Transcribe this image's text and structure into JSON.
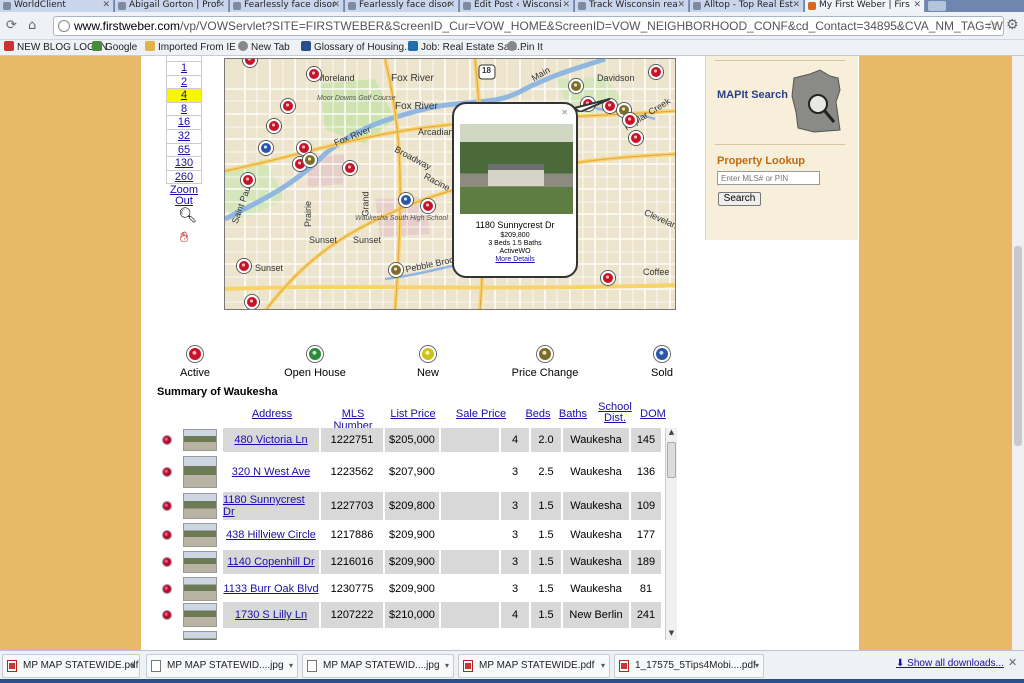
{
  "tabs": [
    {
      "label": "WorldClient"
    },
    {
      "label": "Abigail Gorton | Prof"
    },
    {
      "label": "Fearlessly face disor"
    },
    {
      "label": "Fearlessly face disor"
    },
    {
      "label": "Edit Post ‹ Wisconsi"
    },
    {
      "label": "Track Wisconsin rea"
    },
    {
      "label": "Alltop - Top Real Est"
    },
    {
      "label": "My First Weber | Firs"
    }
  ],
  "address": {
    "host": "www.firstweber.com",
    "path": "/vp/VOWServlet?SITE=FIRSTWEBER&ScreenID_Cur=VOW_HOME&ScreenID=VOW_NEIGHBORHOOD_CONF&cd_Contact=34895&CVA_NM_TAG=Waukesha"
  },
  "bookmarks": [
    {
      "label": "NEW BLOG LOG IN"
    },
    {
      "label": "Google"
    },
    {
      "label": "Imported From IE"
    },
    {
      "label": "New Tab"
    },
    {
      "label": "Glossary of Housing..."
    },
    {
      "label": "Job: Real Estate Sale..."
    },
    {
      "label": "Pin It"
    }
  ],
  "zoom": {
    "levels": [
      "1",
      "2",
      "4",
      "8",
      "16",
      "32",
      "65",
      "130",
      "260"
    ],
    "selected": "4",
    "zoom_out": "Zoom Out"
  },
  "map": {
    "labels": [
      "Fox River",
      "Fox River",
      "Fox River",
      "Moreland",
      "Moor Downs Golf Course",
      "Broadway",
      "Arcadian",
      "Racine",
      "Grand",
      "Sunset",
      "Sunset",
      "Sunset",
      "Waukesha South High School",
      "Pebble Brook",
      "Saint Paul",
      "Prairie",
      "Davidson",
      "Cleveland",
      "Coffee",
      "Main",
      "Poplar Creek"
    ],
    "highway": "18"
  },
  "popup": {
    "address": "1180 Sunnycrest Dr",
    "price": "$209,800",
    "beds_baths": "3 Beds 1.5 Baths",
    "status": "ActiveWO",
    "more": "More Details"
  },
  "legend": [
    "Active",
    "Open House",
    "New",
    "Price Change",
    "Sold"
  ],
  "summary_title": "Summary of Waukesha",
  "columns": [
    "Address",
    "MLS Number",
    "List Price",
    "Sale Price",
    "Beds",
    "Baths",
    "School Dist.",
    "DOM"
  ],
  "listings": [
    {
      "address": "480 Victoria Ln",
      "mls": "1222751",
      "list_price": "$205,000",
      "sale_price": "",
      "beds": "4",
      "baths": "2.0",
      "school": "Waukesha",
      "dom": "145"
    },
    {
      "address": "320 N West Ave",
      "mls": "1223562",
      "list_price": "$207,900",
      "sale_price": "",
      "beds": "3",
      "baths": "2.5",
      "school": "Waukesha",
      "dom": "136"
    },
    {
      "address": "1180 Sunnycrest Dr",
      "mls": "1227703",
      "list_price": "$209,800",
      "sale_price": "",
      "beds": "3",
      "baths": "1.5",
      "school": "Waukesha",
      "dom": "109"
    },
    {
      "address": "438 Hillview Circle",
      "mls": "1217886",
      "list_price": "$209,900",
      "sale_price": "",
      "beds": "3",
      "baths": "1.5",
      "school": "Waukesha",
      "dom": "177"
    },
    {
      "address": "1140 Copenhill Dr",
      "mls": "1216016",
      "list_price": "$209,900",
      "sale_price": "",
      "beds": "3",
      "baths": "1.5",
      "school": "Waukesha",
      "dom": "189"
    },
    {
      "address": "1133 Burr Oak Blvd",
      "mls": "1230775",
      "list_price": "$209,900",
      "sale_price": "",
      "beds": "3",
      "baths": "1.5",
      "school": "Waukesha",
      "dom": "81"
    },
    {
      "address": "1730 S Lilly Ln",
      "mls": "1207222",
      "list_price": "$210,000",
      "sale_price": "",
      "beds": "4",
      "baths": "1.5",
      "school": "New Berlin",
      "dom": "241"
    }
  ],
  "sidebar": {
    "mapit": "MAPIt Search",
    "lookup_title": "Property Lookup",
    "lookup_placeholder": "Enter MLS# or PIN",
    "search_btn": "Search"
  },
  "downloads": [
    {
      "name": "MP MAP STATEWIDE.pdf",
      "kind": "pdf"
    },
    {
      "name": "MP MAP STATEWID....jpg",
      "kind": "jpg"
    },
    {
      "name": "MP MAP STATEWID....jpg",
      "kind": "jpg"
    },
    {
      "name": "MP MAP STATEWIDE.pdf",
      "kind": "pdf"
    },
    {
      "name": "1_17575_5Tips4Mobi....pdf",
      "kind": "pdf"
    }
  ],
  "show_all_downloads": "Show all downloads..."
}
